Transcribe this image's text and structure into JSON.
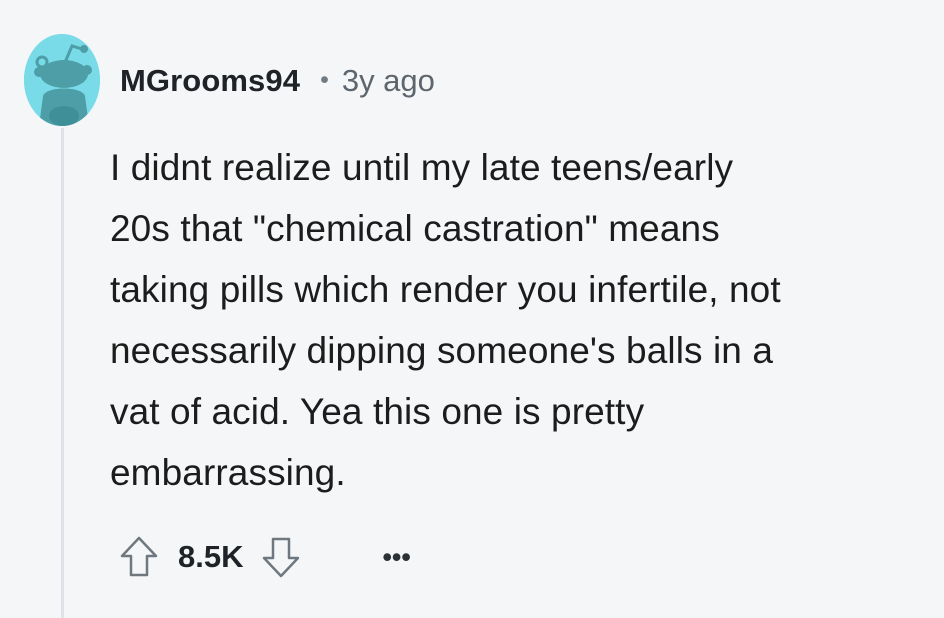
{
  "comment": {
    "author": "MGrooms94",
    "separator": "•",
    "age": "3y ago",
    "body_lines": [
      "I didnt realize until my late teens/early",
      "20s that \"chemical castration\" means",
      "taking pills which render you infertile, not",
      "necessarily dipping someone's balls in a",
      "vat of acid. Yea this one is pretty",
      "embarrassing."
    ],
    "score": "8.5K",
    "more_label": "•••"
  },
  "icons": {
    "avatar": "reddit-snoo-avatar-icon",
    "upvote": "arrow-up-outline-icon",
    "downvote": "arrow-down-outline-icon",
    "more": "ellipsis-icon"
  },
  "colors": {
    "background": "#f5f6f8",
    "avatar_bg": "#79dbe8",
    "thread_line": "#dfe2e6",
    "text_primary": "#1c1c1c",
    "text_secondary": "#5d666d"
  }
}
